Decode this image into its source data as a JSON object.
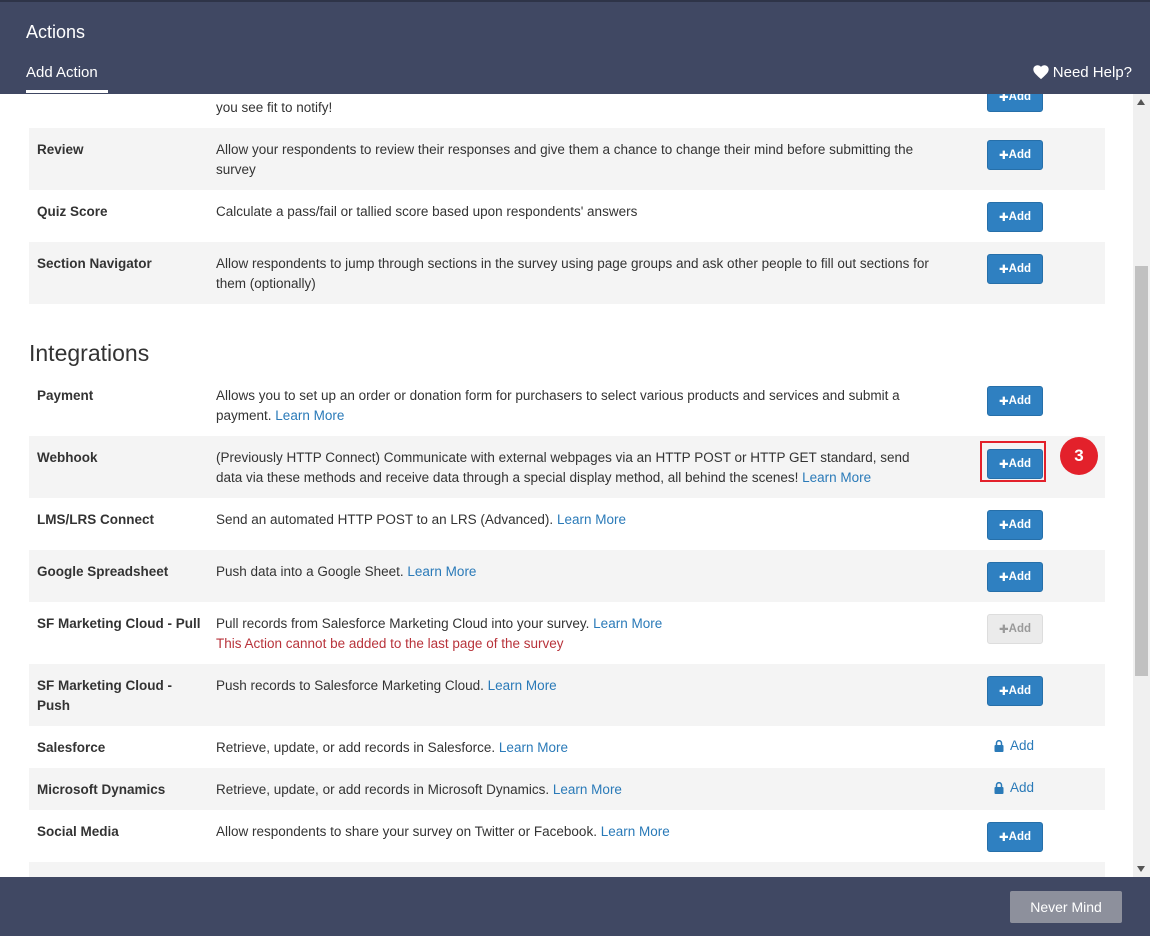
{
  "header": {
    "title": "Actions",
    "tab": "Add Action",
    "help": "Need Help?"
  },
  "add_label": "Add",
  "partial_row": {
    "desc": "you see fit to notify!"
  },
  "rows_top": [
    {
      "name": "Review",
      "desc": "Allow your respondents to review their responses and give them a chance to change their mind before submitting the survey"
    },
    {
      "name": "Quiz Score",
      "desc": "Calculate a pass/fail or tallied score based upon respondents' answers"
    },
    {
      "name": "Section Navigator",
      "desc": "Allow respondents to jump through sections in the survey using page groups and ask other people to fill out sections for them (optionally)"
    }
  ],
  "integrations_title": "Integrations",
  "learn_more": "Learn More",
  "integrations": [
    {
      "name": "Payment",
      "desc": "Allows you to set up an order or donation form for purchasers to select various products and services and submit a payment."
    },
    {
      "name": "Webhook",
      "desc": "(Previously HTTP Connect) Communicate with external webpages via an HTTP POST or HTTP GET standard, send data via these methods and receive data through a special display method, all behind the scenes!"
    },
    {
      "name": "LMS/LRS Connect",
      "desc": "Send an automated HTTP POST to an LRS (Advanced)."
    },
    {
      "name": "Google Spreadsheet",
      "desc": "Push data into a Google Sheet."
    },
    {
      "name": "SF Marketing Cloud - Pull",
      "desc": "Pull records from Salesforce Marketing Cloud into your survey.",
      "error": "This Action cannot be added to the last page of the survey"
    },
    {
      "name": "SF Marketing Cloud - Push",
      "desc": "Push records to Salesforce Marketing Cloud."
    },
    {
      "name": "Salesforce",
      "desc": "Retrieve, update, or add records in Salesforce."
    },
    {
      "name": "Microsoft Dynamics",
      "desc": "Retrieve, update, or add records in Microsoft Dynamics."
    },
    {
      "name": "Social Media",
      "desc": "Allow respondents to share your survey on Twitter or Facebook."
    }
  ],
  "badge": "3",
  "footer": {
    "never_mind": "Never Mind"
  },
  "colors": {
    "header": "#404863",
    "primary": "#2f80c1",
    "link": "#2a7ab8",
    "error": "#b8333b",
    "highlight": "#e3212b"
  }
}
